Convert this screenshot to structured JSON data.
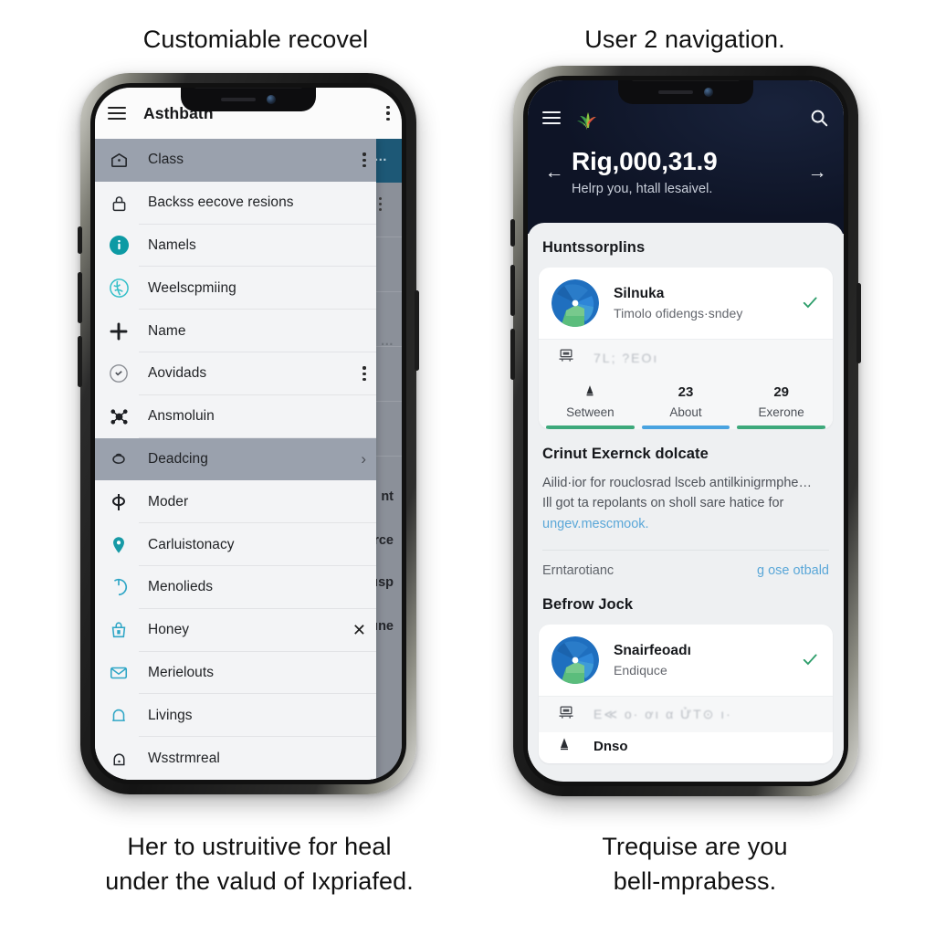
{
  "captions": {
    "top_left": "Customiable recovel",
    "top_right": "User 2 navigation.",
    "bottom_left": "Her to ustruitive for heal\nunder the valud of Ixpriafed.",
    "bottom_right": "Trequise are you\nbell-mprabess."
  },
  "colors": {
    "accent_teal": "#0d9aa4",
    "accent_blue": "#49a3e0",
    "accent_green": "#3da97b",
    "dark_hero": "#0e1426",
    "drawer_bg": "#f3f4f6",
    "selected_row": "#9aa1ad",
    "scrim": "#8b9099",
    "scrim_header": "#1d5876"
  },
  "left_phone": {
    "appbar": {
      "menu_icon": "hamburger-icon",
      "title": "Asthbath",
      "overflow_icon": "kebab-menu-icon"
    },
    "drawer_items": [
      {
        "label": "Class",
        "icon": "home-tag-icon",
        "selected": true,
        "trailing": "kebab-menu-icon"
      },
      {
        "label": "Backss eecove resions",
        "icon": "lock-icon",
        "selected": false,
        "trailing": ""
      },
      {
        "label": "Namels",
        "icon": "info-circle-icon",
        "selected": false,
        "trailing": ""
      },
      {
        "label": "Weelscpmiing",
        "icon": "globe-circle-icon",
        "selected": false,
        "trailing": ""
      },
      {
        "label": "Name",
        "icon": "plus-icon",
        "selected": false,
        "trailing": ""
      },
      {
        "label": "Aovidads",
        "icon": "refresh-circle-icon",
        "selected": false,
        "trailing": "kebab-menu-icon"
      },
      {
        "label": "Ansmoluin",
        "icon": "share-nodes-icon",
        "selected": false,
        "trailing": ""
      },
      {
        "label": "Deadcing",
        "icon": "eye-loop-icon",
        "selected": true,
        "trailing": "chevron-right-icon"
      },
      {
        "label": "Moder",
        "icon": "cross-circle-icon",
        "selected": false,
        "trailing": ""
      },
      {
        "label": "Carluistonacy",
        "icon": "map-pin-icon",
        "selected": false,
        "trailing": ""
      },
      {
        "label": "Menolieds",
        "icon": "power-circle-icon",
        "selected": false,
        "trailing": ""
      },
      {
        "label": "Honey",
        "icon": "tote-bag-icon",
        "selected": false,
        "trailing": "close-icon"
      },
      {
        "label": "Merielouts",
        "icon": "envelope-icon",
        "selected": false,
        "trailing": ""
      },
      {
        "label": "Livings",
        "icon": "bell-icon",
        "selected": false,
        "trailing": ""
      },
      {
        "label": "Wsstrmreal",
        "icon": "lock-bell-icon",
        "selected": false,
        "trailing": ""
      }
    ],
    "background_fragments": [
      "…",
      "…",
      "nt",
      "rce",
      "ısp",
      "ınе"
    ]
  },
  "right_phone": {
    "hero": {
      "menu_icon": "hamburger-icon",
      "logo_icon": "leaf-burst-logo-icon",
      "search_icon": "search-icon",
      "prev_icon": "arrow-left-icon",
      "next_icon": "arrow-right-icon",
      "title": "Rig,000,31.9",
      "subtitle": "Helrp you, htall lesaivel."
    },
    "section_one": {
      "title": "Huntssorplins",
      "card": {
        "name": "Silnuka",
        "subtitle": "Timolo ofidengs·sndey",
        "status_icon": "check-icon",
        "meta_icon": "ticket-icon",
        "meta_text": "7L; ?ЕOı",
        "stats": [
          {
            "value": "",
            "label": "Setween",
            "icon": "alert-icon",
            "bar_color": "#3da97b"
          },
          {
            "value": "23",
            "label": "About",
            "icon": "",
            "bar_color": "#49a3e0"
          },
          {
            "value": "29",
            "label": "Exerone",
            "icon": "",
            "bar_color": "#3da97b"
          }
        ]
      }
    },
    "block": {
      "title": "Crinut Exernck dolcate",
      "body_line_1": "Ailid·ior for rouclosrad lsceb antilkinigrmphe…",
      "body_line_2": "Ill got ta repolants on sholl sare hatice for",
      "link_text": "ungev.mescmook.",
      "footer_left": "Erntarotianc",
      "footer_right": "ɡ ose otbald"
    },
    "section_two": {
      "title": "Befrow Jock",
      "card": {
        "name": "Snairfeoadı",
        "subtitle": "Endiquce",
        "status_icon": "check-icon",
        "meta_icon": "ticket-icon",
        "meta_text": "Е≪ ο· ơı α ỬT⊙ ı·",
        "tail_icon": "alert-icon",
        "tail_text": "Dnso"
      }
    }
  }
}
